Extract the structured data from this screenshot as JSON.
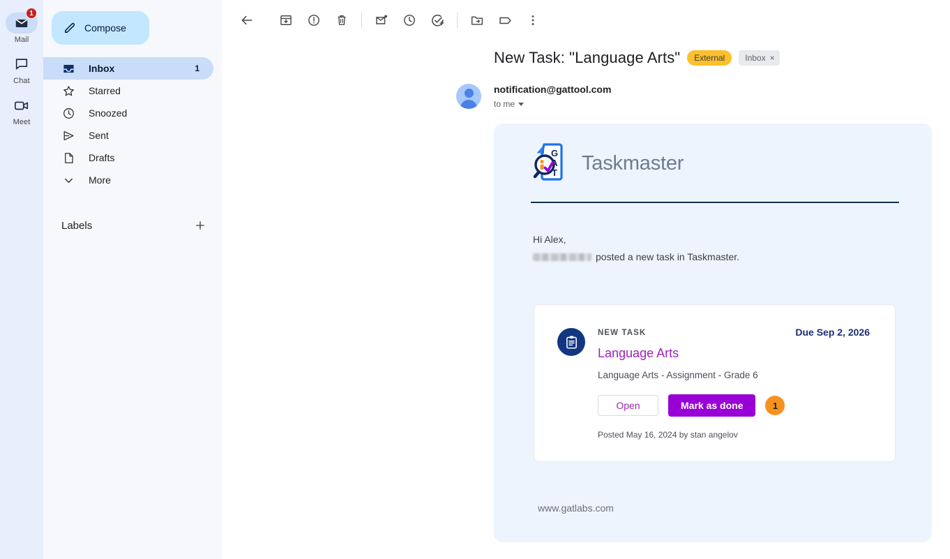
{
  "rail": {
    "items": [
      {
        "label": "Mail",
        "icon": "mail-icon",
        "badge": "1",
        "active": true
      },
      {
        "label": "Chat",
        "icon": "chat-icon",
        "badge": "",
        "active": false
      },
      {
        "label": "Meet",
        "icon": "meet-icon",
        "badge": "",
        "active": false
      }
    ]
  },
  "sidebar": {
    "compose": {
      "label": "Compose",
      "icon": "pencil-icon"
    },
    "nav": [
      {
        "label": "Inbox",
        "icon": "inbox-icon",
        "count": "1",
        "active": true
      },
      {
        "label": "Starred",
        "icon": "star-icon",
        "count": "",
        "active": false
      },
      {
        "label": "Snoozed",
        "icon": "clock-icon",
        "count": "",
        "active": false
      },
      {
        "label": "Sent",
        "icon": "send-icon",
        "count": "",
        "active": false
      },
      {
        "label": "Drafts",
        "icon": "draft-icon",
        "count": "",
        "active": false
      },
      {
        "label": "More",
        "icon": "chevron-down-icon",
        "count": "",
        "active": false
      }
    ],
    "labels_title": "Labels",
    "add_label_icon": "plus-icon"
  },
  "toolbar": {
    "buttons": [
      {
        "name": "back-button",
        "icon": "arrow-left-icon"
      },
      {
        "name": "archive-button",
        "icon": "archive-icon"
      },
      {
        "name": "report-spam-button",
        "icon": "exclamation-circle-icon"
      },
      {
        "name": "delete-button",
        "icon": "trash-icon"
      },
      {
        "name": "mark-unread-button",
        "icon": "mark-unread-icon"
      },
      {
        "name": "snooze-button",
        "icon": "clock-icon"
      },
      {
        "name": "add-to-tasks-button",
        "icon": "check-circle-plus-icon"
      },
      {
        "name": "move-to-button",
        "icon": "folder-move-icon"
      },
      {
        "name": "label-button",
        "icon": "tag-icon"
      },
      {
        "name": "more-options-button",
        "icon": "more-vertical-icon"
      }
    ]
  },
  "email": {
    "subject": "New Task: \"Language Arts\"",
    "external_badge": "External",
    "inbox_chip": "Inbox",
    "inbox_chip_close": "×",
    "sender": "notification@gattool.com",
    "recipient": "to me",
    "brand": "Taskmaster",
    "greeting": "Hi Alex,",
    "intro_suffix": "posted a new task in Taskmaster.",
    "footer_url": "www.gatlabs.com"
  },
  "task_card": {
    "eyebrow": "NEW TASK",
    "due": "Due Sep 2, 2026",
    "title": "Language Arts",
    "description": "Language Arts - Assignment - Grade 6",
    "open_label": "Open",
    "done_label": "Mark as done",
    "count_badge": "1",
    "posted": "Posted May 16, 2024 by stan angelov"
  },
  "colors": {
    "rail_bg": "#e8eefb",
    "sidebar_bg": "#f6f8fc",
    "compose_bg": "#c2e7ff",
    "active_nav_bg": "#c9dcf8",
    "email_panel_bg": "#eef4fd",
    "external_badge": "#fbc02d",
    "task_title_purple": "#a020c0",
    "primary_button_purple": "#9900d6",
    "count_badge_orange": "#f5921e",
    "navy": "#123682",
    "due_navy": "#1d2f74"
  }
}
